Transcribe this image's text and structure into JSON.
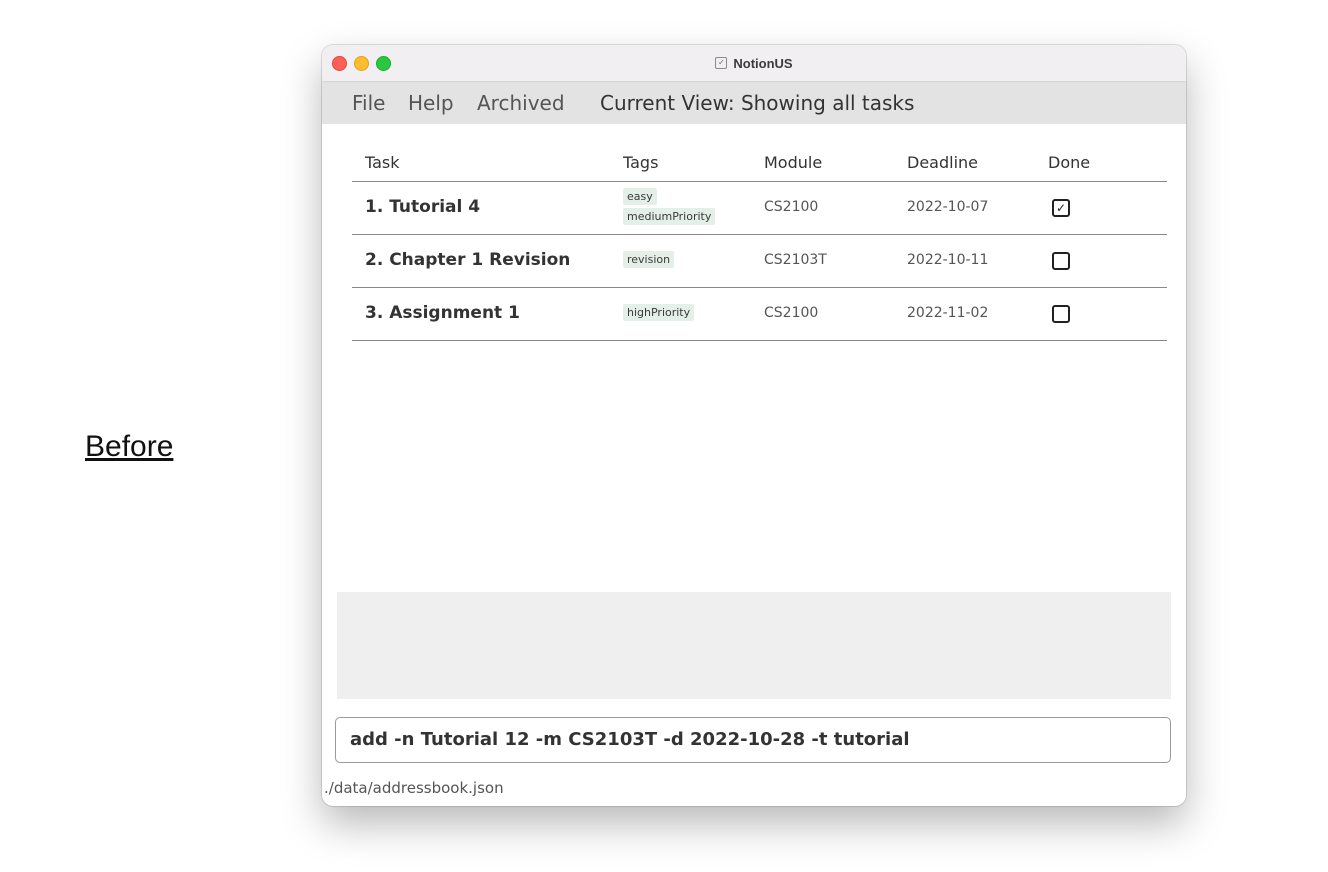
{
  "caption": "Before",
  "window": {
    "title": "NotionUS",
    "icon": "checkbox-icon"
  },
  "menu": {
    "file": "File",
    "help": "Help",
    "archived": "Archived",
    "current_view": "Current View: Showing all tasks"
  },
  "table": {
    "headers": {
      "task": "Task",
      "tags": "Tags",
      "module": "Module",
      "deadline": "Deadline",
      "done": "Done"
    },
    "rows": [
      {
        "task": "1. Tutorial 4",
        "tags": [
          "easy",
          "mediumPriority"
        ],
        "module": "CS2100",
        "deadline": "2022-10-07",
        "done": true,
        "done_mark": "✓"
      },
      {
        "task": "2. Chapter 1 Revision",
        "tags": [
          "revision"
        ],
        "module": "CS2103T",
        "deadline": "2022-10-11",
        "done": false,
        "done_mark": ""
      },
      {
        "task": "3. Assignment 1",
        "tags": [
          "highPriority"
        ],
        "module": "CS2100",
        "deadline": "2022-11-02",
        "done": false,
        "done_mark": ""
      }
    ]
  },
  "result": "",
  "command": {
    "value": "add -n Tutorial 12 -m CS2103T -d 2022-10-28 -t tutorial"
  },
  "status": "./data/addressbook.json",
  "colors": {
    "tag_bg": "#e4efe8",
    "close": "#fe5f57",
    "minimize": "#febc2e",
    "zoom": "#28c840"
  }
}
